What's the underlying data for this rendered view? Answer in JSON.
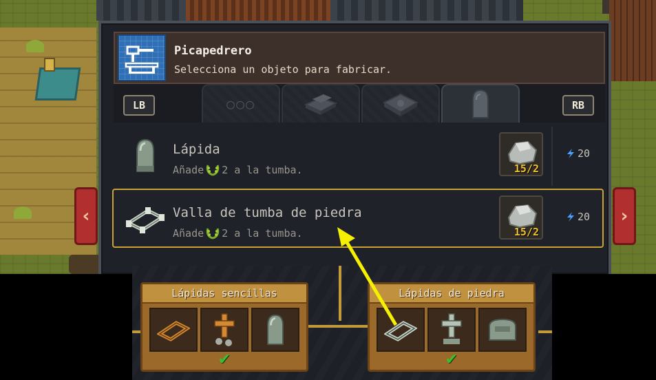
{
  "window": {
    "title": "Picapedrero",
    "subtitle": "Selecciona un objeto para fabricar.",
    "left_shoulder": "LB",
    "right_shoulder": "RB",
    "tab_more": "○○○"
  },
  "recipes": [
    {
      "name": "Lápida",
      "desc_prefix": "Añade",
      "desc_suffix": "2 a la tumba.",
      "cost": "15/2",
      "energy": "20",
      "icon": "gravestone-icon",
      "selected": false
    },
    {
      "name": "Valla de tumba de piedra",
      "desc_prefix": "Añade",
      "desc_suffix": "2 a la tumba.",
      "cost": "15/2",
      "energy": "20",
      "icon": "stone-fence-icon",
      "selected": true
    }
  ],
  "tech_tree": {
    "nodes": [
      {
        "title": "Lápidas sencillas",
        "items": [
          "wooden-fence-icon",
          "wooden-cross-icon",
          "gravestone-icon"
        ],
        "unlocked": "✔"
      },
      {
        "title": "Lápidas de piedra",
        "items": [
          "stone-fence-icon",
          "stone-cross-icon",
          "stone-tomb-icon"
        ],
        "unlocked": "✔"
      }
    ]
  },
  "colors": {
    "accent_gold": "#c9a432",
    "cost_yellow": "#f2c029",
    "energy_blue": "#4aa3ff",
    "arrow_red": "#b22f2f",
    "pointer_yellow": "#f5f000"
  }
}
